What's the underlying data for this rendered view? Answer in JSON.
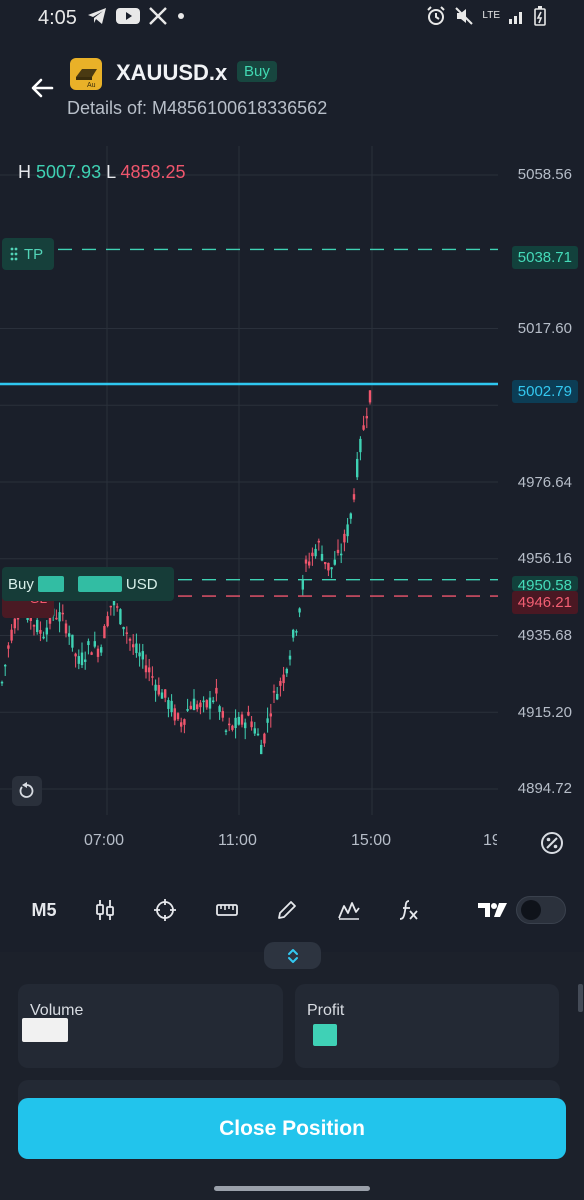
{
  "status_bar": {
    "time": "4:05",
    "left_icons": [
      "telegram-icon",
      "youtube-icon",
      "x-icon",
      "dot-icon"
    ],
    "right_icons": [
      "alarm-icon",
      "mute-icon",
      "lte-icon",
      "signal-icon",
      "battery-icon"
    ],
    "network": "LTE"
  },
  "header": {
    "symbol": "XAUUSD.x",
    "logo_text": "Au",
    "side": "Buy",
    "details": "Details of: M4856100618336562"
  },
  "chart": {
    "high_label": "H",
    "high_value": "5007.93",
    "low_label": "L",
    "low_value": "4858.25",
    "price_axis": [
      "5058.56",
      "5017.60",
      "4976.64",
      "4956.16",
      "4935.68",
      "4915.20",
      "4894.72"
    ],
    "time_axis": [
      "07:00",
      "11:00",
      "15:00",
      "19"
    ],
    "tp_chip": "TP",
    "tp_price": "5038.71",
    "current_price": "5002.79",
    "sl_chip": "SL",
    "sl_price": "4946.21",
    "entry_price": "4950.58",
    "entry_label_prefix": "Buy",
    "entry_label_suffix": "USD",
    "colors": {
      "up": "#3fd2b4",
      "down": "#f0566d",
      "current": "#2fc7ef",
      "background": "#1a1f2a"
    }
  },
  "toolbar": {
    "timeframe": "M5",
    "tools": [
      "candles-icon",
      "crosshair-icon",
      "ruler-icon",
      "pencil-icon",
      "indicators-icon",
      "fx-icon"
    ],
    "brand": "tradingview-logo-icon",
    "toggle_on": false
  },
  "panel": {
    "volume_label": "Volume",
    "profit_label": "Profit",
    "close_button": "Close Position"
  }
}
